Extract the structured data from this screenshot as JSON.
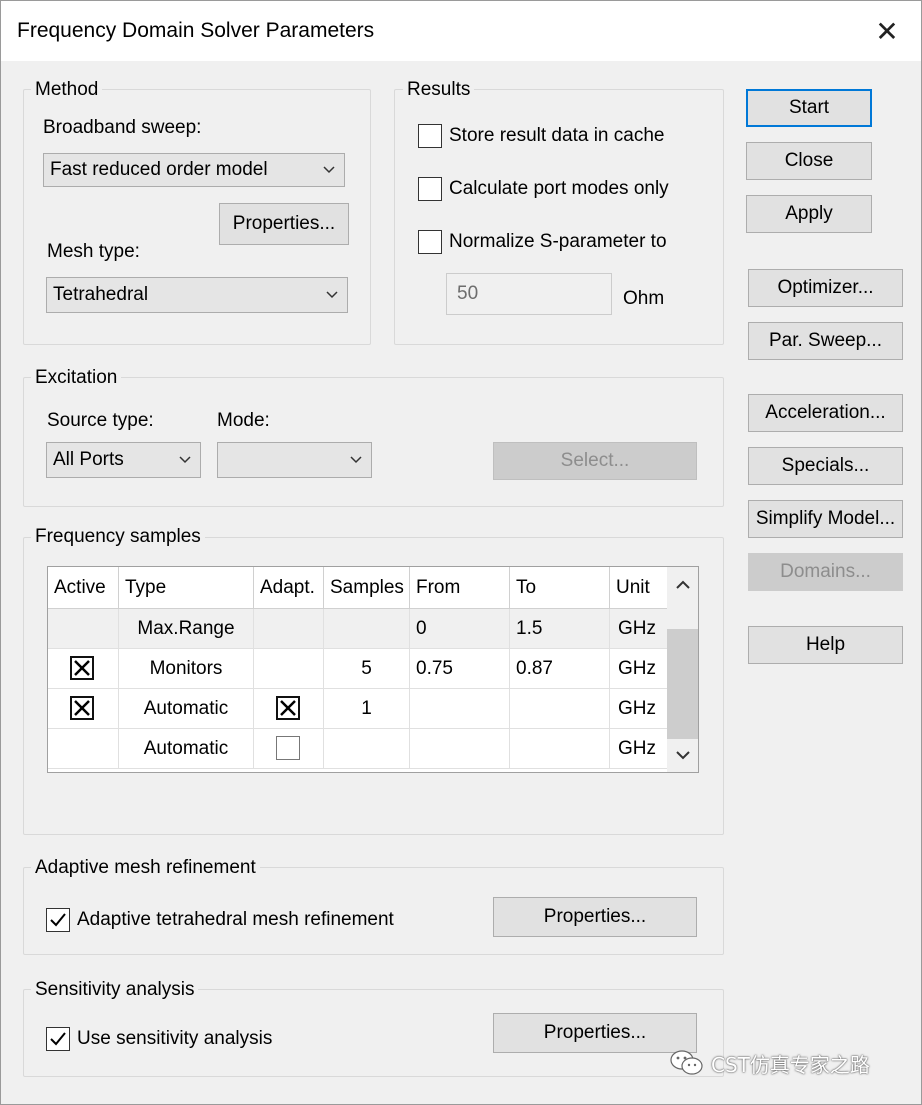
{
  "window": {
    "title": "Frequency Domain Solver Parameters",
    "close_glyph": "✕"
  },
  "method": {
    "title": "Method",
    "broadband_label": "Broadband sweep:",
    "broadband_value": "Fast reduced order model",
    "properties_label": "Properties...",
    "mesh_label": "Mesh type:",
    "mesh_value": "Tetrahedral"
  },
  "results": {
    "title": "Results",
    "store_label": "Store result data in cache",
    "store_checked": false,
    "port_modes_label": "Calculate port modes only",
    "port_modes_checked": false,
    "normalize_label": "Normalize S-parameter to",
    "normalize_checked": false,
    "impedance_value": "50",
    "impedance_unit": "Ohm"
  },
  "side_buttons": {
    "start": "Start",
    "close": "Close",
    "apply": "Apply",
    "optimizer": "Optimizer...",
    "par_sweep": "Par. Sweep...",
    "acceleration": "Acceleration...",
    "specials": "Specials...",
    "simplify": "Simplify Model...",
    "domains": "Domains...",
    "help": "Help"
  },
  "excitation": {
    "title": "Excitation",
    "source_label": "Source type:",
    "source_value": "All Ports",
    "mode_label": "Mode:",
    "mode_value": "",
    "select_label": "Select..."
  },
  "frequency_samples": {
    "title": "Frequency samples",
    "columns": [
      "Active",
      "Type",
      "Adapt.",
      "Samples",
      "From",
      "To",
      "Unit"
    ],
    "rows": [
      {
        "active": null,
        "type": "Max.Range",
        "adapt": null,
        "samples": "",
        "from": "0",
        "to": "1.5",
        "unit": "GHz"
      },
      {
        "active": true,
        "type": "Monitors",
        "adapt": null,
        "samples": "5",
        "from": "0.75",
        "to": "0.87",
        "unit": "GHz"
      },
      {
        "active": true,
        "type": "Automatic",
        "adapt": true,
        "samples": "1",
        "from": "",
        "to": "",
        "unit": "GHz"
      },
      {
        "active": null,
        "type": "Automatic",
        "adapt": false,
        "samples": "",
        "from": "",
        "to": "",
        "unit": "GHz"
      }
    ]
  },
  "adaptive_mesh": {
    "title": "Adaptive mesh refinement",
    "checkbox_label": "Adaptive tetrahedral mesh refinement",
    "checked": true,
    "properties_label": "Properties..."
  },
  "sensitivity": {
    "title": "Sensitivity analysis",
    "checkbox_label": "Use sensitivity analysis",
    "checked": true,
    "properties_label": "Properties..."
  },
  "watermark": {
    "text": "CST仿真专家之路",
    "icon": "wechat-icon"
  },
  "colors": {
    "accent": "#0078d7",
    "dialog_bg": "#f0f0f0",
    "disabled_text": "#8d8d8d"
  }
}
